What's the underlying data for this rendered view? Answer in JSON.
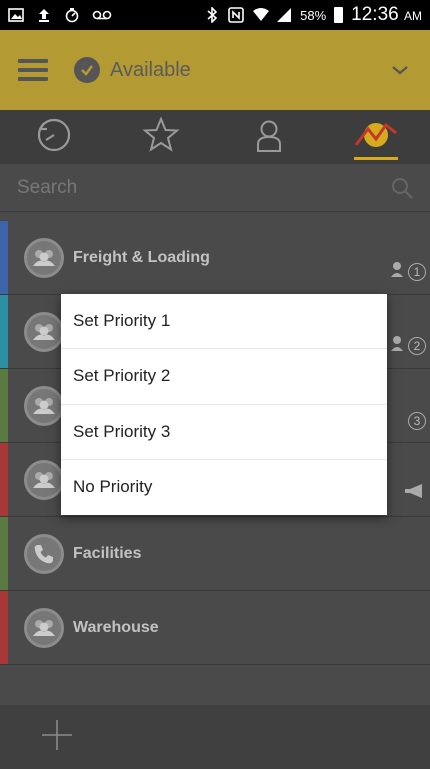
{
  "statusbar": {
    "battery": "58%",
    "time": "12:36",
    "ampm": "AM"
  },
  "appbar": {
    "status": "Available"
  },
  "search": {
    "placeholder": "Search"
  },
  "groups": [
    {
      "label": "Freight & Loading",
      "priority": "1",
      "color": "#3f63a8"
    },
    {
      "label": "",
      "priority": "2",
      "color": "#2d8fa3"
    },
    {
      "label": "",
      "priority": "3",
      "color": "#5a7a42"
    },
    {
      "label": "",
      "priority": "",
      "color": "#a83838"
    },
    {
      "label": "Facilities",
      "priority": "",
      "color": "#5a7a42"
    },
    {
      "label": "Warehouse",
      "priority": "",
      "color": "#a83838"
    }
  ],
  "menu": {
    "items": [
      "Set Priority 1",
      "Set Priority 2",
      "Set Priority 3",
      "No Priority"
    ]
  },
  "colors": {
    "appbar": "#b39a33",
    "accent": "#d8ab1e"
  }
}
